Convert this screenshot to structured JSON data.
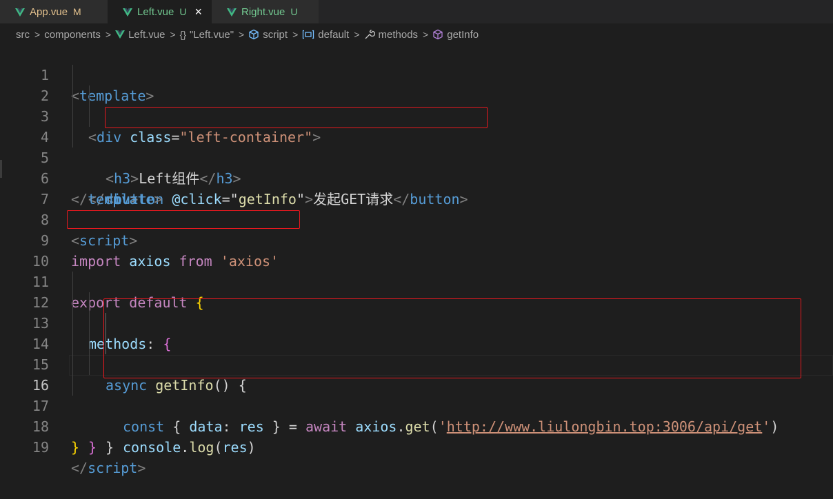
{
  "tabs": [
    {
      "name": "App.vue",
      "status": "M"
    },
    {
      "name": "Left.vue",
      "status": "U",
      "close": "×"
    },
    {
      "name": "Right.vue",
      "status": "U"
    }
  ],
  "breadcrumb": {
    "items": [
      "src",
      "components",
      "Left.vue",
      "\"Left.vue\"",
      "script",
      "default",
      "methods",
      "getInfo"
    ],
    "braces_glyph": "{}",
    "separator": ">"
  },
  "line_numbers": [
    "1",
    "2",
    "3",
    "4",
    "5",
    "6",
    "7",
    "8",
    "9",
    "10",
    "11",
    "12",
    "13",
    "14",
    "15",
    "16",
    "17",
    "18",
    "19"
  ],
  "current_line": "16",
  "code": {
    "l1": {
      "lt": "<",
      "tag": "template",
      "gt": ">"
    },
    "l2": {
      "lt": "<",
      "tag": "div",
      "attr": "class",
      "eq": "=",
      "val": "\"left-container\"",
      "gt": ">"
    },
    "l3": {
      "lt": "<",
      "tag": "h3",
      "gt": ">",
      "text": "Left组件",
      "clt": "</",
      "ctag": "h3",
      "cgt": ">"
    },
    "l4": {
      "lt": "<",
      "tag": "button",
      "attr": "@click",
      "eq": "=",
      "q1": "\"",
      "fn": "getInfo",
      "q2": "\"",
      "gt": ">",
      "text": "发起GET请求",
      "clt": "</",
      "ctag": "button",
      "cgt": ">"
    },
    "l5": {
      "clt": "</",
      "ctag": "div",
      "cgt": ">"
    },
    "l6": {
      "clt": "</",
      "ctag": "template",
      "cgt": ">"
    },
    "l8": {
      "lt": "<",
      "tag": "script",
      "gt": ">"
    },
    "l9": {
      "kw1": "import",
      "name": "axios",
      "kw2": "from",
      "str": "'axios'"
    },
    "l11": {
      "kw1": "export",
      "kw2": "default",
      "brace": "{"
    },
    "l12": {
      "prop": "methods",
      "colon": ":",
      "brace": "{"
    },
    "l13": {
      "kw": "async",
      "fn": "getInfo",
      "parens": "()",
      "brace": "{"
    },
    "l14": {
      "kw": "const",
      "ob": "{",
      "prop": "data",
      "colon": ":",
      "var": "res",
      "cb": "}",
      "eq": "=",
      "await": "await",
      "obj": "axios",
      "dot": ".",
      "fn": "get",
      "op": "(",
      "q1": "'",
      "url": "http://www.liulongbin.top:3006/api/get",
      "q2": "'",
      "cp": ")"
    },
    "l15": {
      "obj": "console",
      "dot": ".",
      "fn": "log",
      "op": "(",
      "var": "res",
      "cp": ")"
    },
    "l16": {
      "brace": "}"
    },
    "l17": {
      "brace": "}"
    },
    "l18": {
      "brace": "}"
    },
    "l19": {
      "clt": "</",
      "ctag": "script",
      "cgt": ">"
    }
  },
  "colors": {
    "background": "#1e1e1e",
    "highlight_box": "#e8191f",
    "vue_icon": "#41b883"
  }
}
